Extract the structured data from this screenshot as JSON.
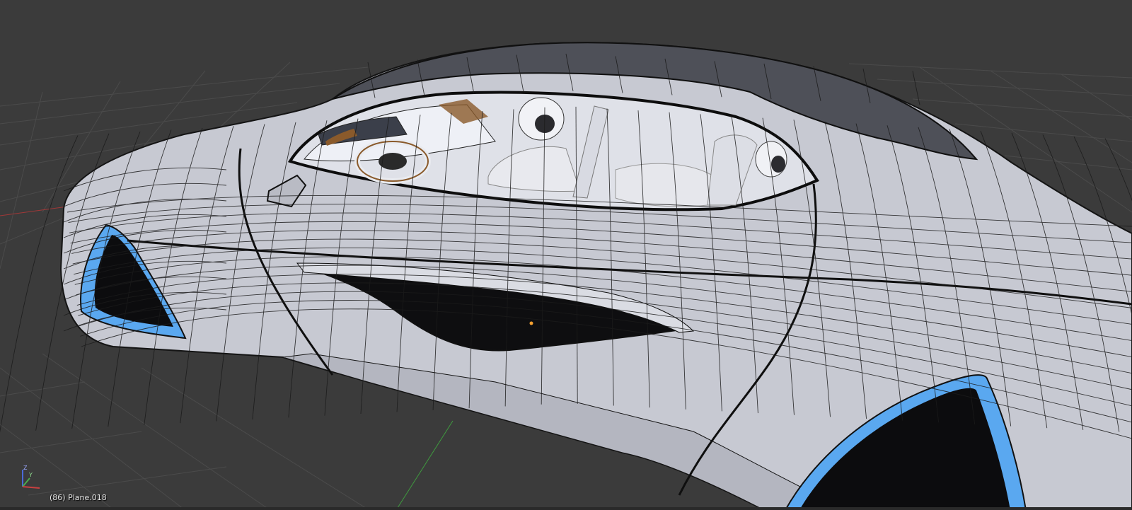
{
  "viewport": {
    "object_info": "(86) Plane.018",
    "axis_labels": {
      "z": "Z",
      "y": "Y"
    },
    "view_mode": "wireframe-on-solid",
    "colors": {
      "background": "#3b3b3b",
      "grid": "#4a4a4a",
      "body": "#c9cbd4",
      "wire": "#1a1a1a",
      "glass_dark": "#0e0e10",
      "accent_blue": "#5aa8f0",
      "roof": "#4e5058",
      "interior": "#e6e8ef",
      "wood": "#8a5a2b",
      "axis_x": "#c84040",
      "axis_y": "#4caa4c",
      "axis_z": "#4a6ad8"
    }
  }
}
